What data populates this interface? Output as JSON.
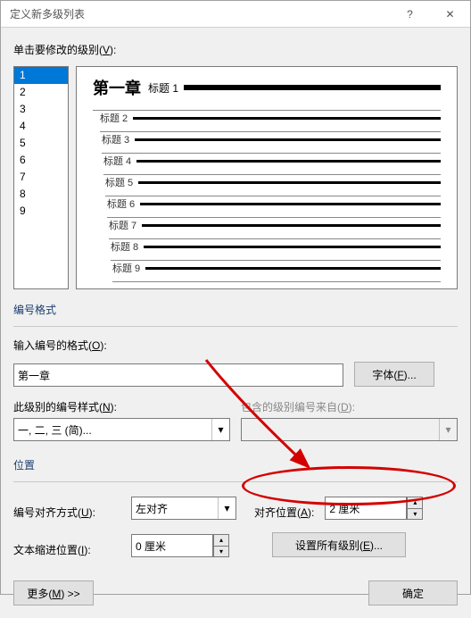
{
  "titlebar": {
    "title": "定义新多级列表"
  },
  "labels": {
    "click_level": "单击要修改的级别(",
    "click_level_u": "V",
    "click_level_end": "):",
    "number_format_group": "编号格式",
    "enter_number_format": "输入编号的格式(",
    "enter_number_format_u": "O",
    "enter_number_format_end": "):",
    "font_btn": "字体(",
    "font_btn_u": "F",
    "font_btn_end": ")...",
    "number_style": "此级别的编号样式(",
    "number_style_u": "N",
    "number_style_end": "):",
    "include_from": "包含的级别编号来自(",
    "include_from_u": "D",
    "include_from_end": "):",
    "position_group": "位置",
    "align_mode": "编号对齐方式(",
    "align_mode_u": "U",
    "align_mode_end": "):",
    "align_at": "对齐位置(",
    "align_at_u": "A",
    "align_at_end": "):",
    "text_indent": "文本缩进位置(",
    "text_indent_u": "I",
    "text_indent_end": "):",
    "set_all": "设置所有级别(",
    "set_all_u": "E",
    "set_all_end": ")...",
    "more": "更多(",
    "more_u": "M",
    "more_end": ") >>",
    "ok": "确定"
  },
  "levels": [
    "1",
    "2",
    "3",
    "4",
    "5",
    "6",
    "7",
    "8",
    "9"
  ],
  "selected_level_index": 0,
  "preview": {
    "chapter": "第一章",
    "heading_prefix": "标题",
    "items": [
      "标题 1",
      "标题 2",
      "标题 3",
      "标题 4",
      "标题 5",
      "标题 6",
      "标题 7",
      "标题 8",
      "标题 9"
    ]
  },
  "values": {
    "number_format_text": "第一章",
    "number_style": "一, 二, 三 (简)...",
    "include_from": "",
    "align_mode": "左对齐",
    "align_at": "2 厘米",
    "text_indent": "0 厘米"
  }
}
